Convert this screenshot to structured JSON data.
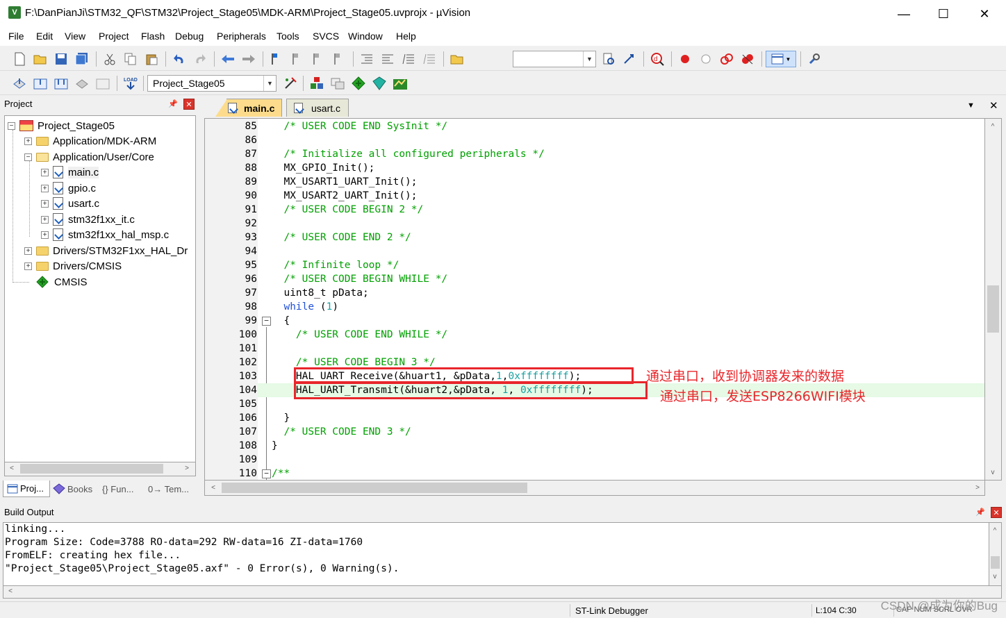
{
  "window": {
    "title": "F:\\DanPianJi\\STM32_QF\\STM32\\Project_Stage05\\MDK-ARM\\Project_Stage05.uvprojx - µVision",
    "controls": {
      "minimize": "—",
      "maximize": "☐",
      "close": "✕"
    }
  },
  "menu": [
    "File",
    "Edit",
    "View",
    "Project",
    "Flash",
    "Debug",
    "Peripherals",
    "Tools",
    "SVCS",
    "Window",
    "Help"
  ],
  "toolbar": {
    "target_name": "Project_Stage05",
    "load_label": "LOAD"
  },
  "project_panel": {
    "title": "Project",
    "tree": [
      {
        "label": "Project_Stage05",
        "kind": "project",
        "level": 0
      },
      {
        "label": "Application/MDK-ARM",
        "kind": "folder",
        "level": 1
      },
      {
        "label": "Application/User/Core",
        "kind": "folder-open",
        "level": 1
      },
      {
        "label": "main.c",
        "kind": "file",
        "level": 2
      },
      {
        "label": "gpio.c",
        "kind": "file",
        "level": 2
      },
      {
        "label": "usart.c",
        "kind": "file",
        "level": 2
      },
      {
        "label": "stm32f1xx_it.c",
        "kind": "file",
        "level": 2
      },
      {
        "label": "stm32f1xx_hal_msp.c",
        "kind": "file",
        "level": 2
      },
      {
        "label": "Drivers/STM32F1xx_HAL_Dr",
        "kind": "folder",
        "level": 1
      },
      {
        "label": "Drivers/CMSIS",
        "kind": "folder",
        "level": 1
      },
      {
        "label": "CMSIS",
        "kind": "component",
        "level": 1
      }
    ],
    "tabs": [
      "Proj...",
      "Books",
      "{} Fun...",
      "0→ Tem..."
    ]
  },
  "editor": {
    "tabs": [
      "main.c",
      "usart.c"
    ],
    "active_tab": "main.c",
    "lines": [
      {
        "n": "85",
        "text": "  /* USER CODE END SysInit */"
      },
      {
        "n": "86",
        "text": ""
      },
      {
        "n": "87",
        "text": "  /* Initialize all configured peripherals */"
      },
      {
        "n": "88",
        "text": "  MX_GPIO_Init();"
      },
      {
        "n": "89",
        "text": "  MX_USART1_UART_Init();"
      },
      {
        "n": "90",
        "text": "  MX_USART2_UART_Init();"
      },
      {
        "n": "91",
        "text": "  /* USER CODE BEGIN 2 */"
      },
      {
        "n": "92",
        "text": ""
      },
      {
        "n": "93",
        "text": "  /* USER CODE END 2 */"
      },
      {
        "n": "94",
        "text": ""
      },
      {
        "n": "95",
        "text": "  /* Infinite loop */"
      },
      {
        "n": "96",
        "text": "  /* USER CODE BEGIN WHILE */"
      },
      {
        "n": "97",
        "text": "  uint8_t pData;"
      },
      {
        "n": "98",
        "text": "  while (1)"
      },
      {
        "n": "99",
        "text": "  {"
      },
      {
        "n": "100",
        "text": "    /* USER CODE END WHILE */"
      },
      {
        "n": "101",
        "text": ""
      },
      {
        "n": "102",
        "text": "    /* USER CODE BEGIN 3 */"
      },
      {
        "n": "103",
        "text": "    HAL_UART_Receive(&huart1, &pData,1,0xffffffff);"
      },
      {
        "n": "104",
        "text": "    HAL_UART_Transmit(&huart2,&pData, 1, 0xffffffff);"
      },
      {
        "n": "105",
        "text": ""
      },
      {
        "n": "106",
        "text": "  }"
      },
      {
        "n": "107",
        "text": "  /* USER CODE END 3 */"
      },
      {
        "n": "108",
        "text": "}"
      },
      {
        "n": "109",
        "text": ""
      },
      {
        "n": "110",
        "text": "/**"
      }
    ],
    "annotations": [
      "通过串口，收到协调器发来的数据",
      "通过串口，发送ESP8266WIFI模块"
    ],
    "current_line": "104"
  },
  "build_output": {
    "title": "Build Output",
    "lines": [
      "linking...",
      "Program Size: Code=3788 RO-data=292 RW-data=16 ZI-data=1760",
      "FromELF: creating hex file...",
      "\"Project_Stage05\\Project_Stage05.axf\" - 0 Error(s), 0 Warning(s)."
    ]
  },
  "status": {
    "debugger": "ST-Link Debugger",
    "position": "L:104 C:30",
    "indicators": "CAP NUM SCRL OVR"
  },
  "watermark": "CSDN @成为你的Bug",
  "colors": {
    "comment": "#00a000",
    "keyword": "#2050d8",
    "number": "#19a0a0",
    "annotation": "#e8262b",
    "active_tab": "#fcdc8c"
  }
}
